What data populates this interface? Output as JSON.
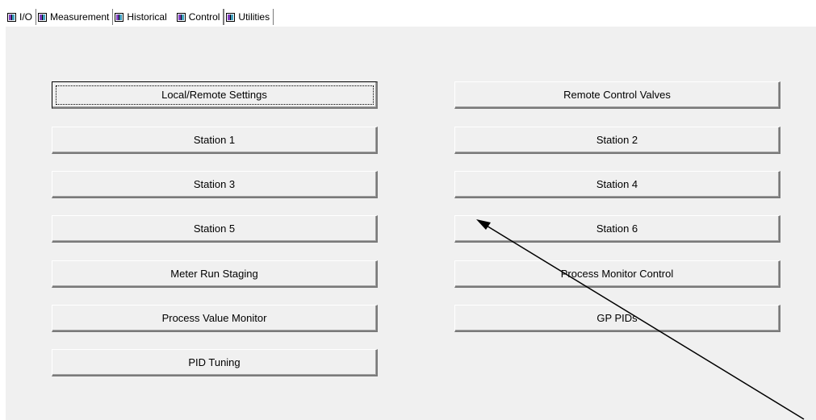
{
  "tabs": [
    "I/O",
    "Measurement",
    "Historical",
    "Control",
    "Utilities"
  ],
  "active_tab": "Control",
  "buttons": {
    "local_remote_settings": "Local/Remote Settings",
    "remote_control_valves": "Remote Control Valves",
    "station_1": "Station 1",
    "station_2": "Station 2",
    "station_3": "Station 3",
    "station_4": "Station 4",
    "station_5": "Station 5",
    "station_6": "Station 6",
    "meter_run_staging": "Meter Run Staging",
    "process_monitor_control": "Process Monitor Control",
    "process_value_monitor": "Process Value Monitor",
    "gp_pids": "GP PIDs",
    "pid_tuning": "PID Tuning"
  },
  "annotation": {
    "icon": "arrow-icon"
  }
}
